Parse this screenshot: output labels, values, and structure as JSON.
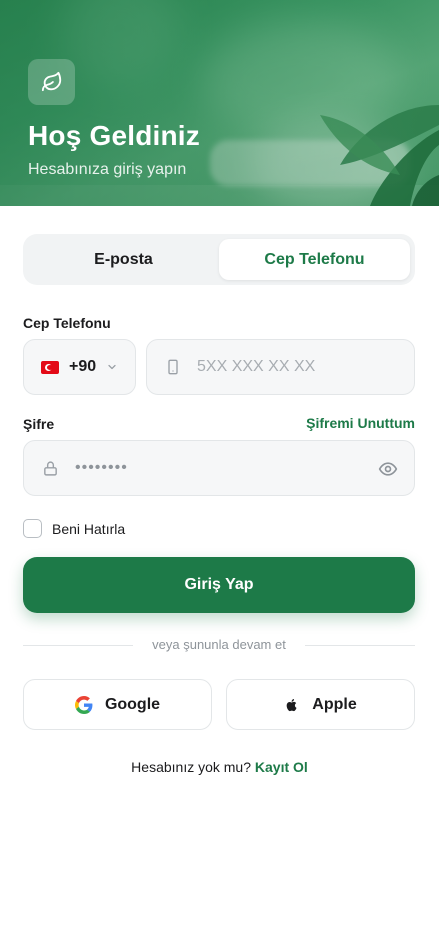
{
  "header": {
    "title": "Hoş Geldiniz",
    "subtitle": "Hesabınıza giriş yapın",
    "logo_icon": "leaf-icon"
  },
  "tabs": [
    {
      "label": "E-posta",
      "active": false
    },
    {
      "label": "Cep Telefonu",
      "active": true
    }
  ],
  "phone": {
    "label": "Cep Telefonu",
    "country_flag": "turkey-flag",
    "country_code": "+90",
    "placeholder": "5XX XXX XX XX"
  },
  "password": {
    "label": "Şifre",
    "forgot_label": "Şifremi Unuttum",
    "masked_value": "••••••••"
  },
  "remember": {
    "label": "Beni Hatırla",
    "checked": false
  },
  "login_button": {
    "label": "Giriş Yap"
  },
  "divider_text": "veya şununla devam et",
  "social": {
    "google_label": "Google",
    "apple_label": "Apple"
  },
  "signup": {
    "prompt": "Hesabınız yok mu?",
    "link": "Kayıt Ol"
  },
  "colors": {
    "primary": "#1d7a48",
    "input_bg": "#f6f7f8",
    "border": "#e3e6e8"
  }
}
